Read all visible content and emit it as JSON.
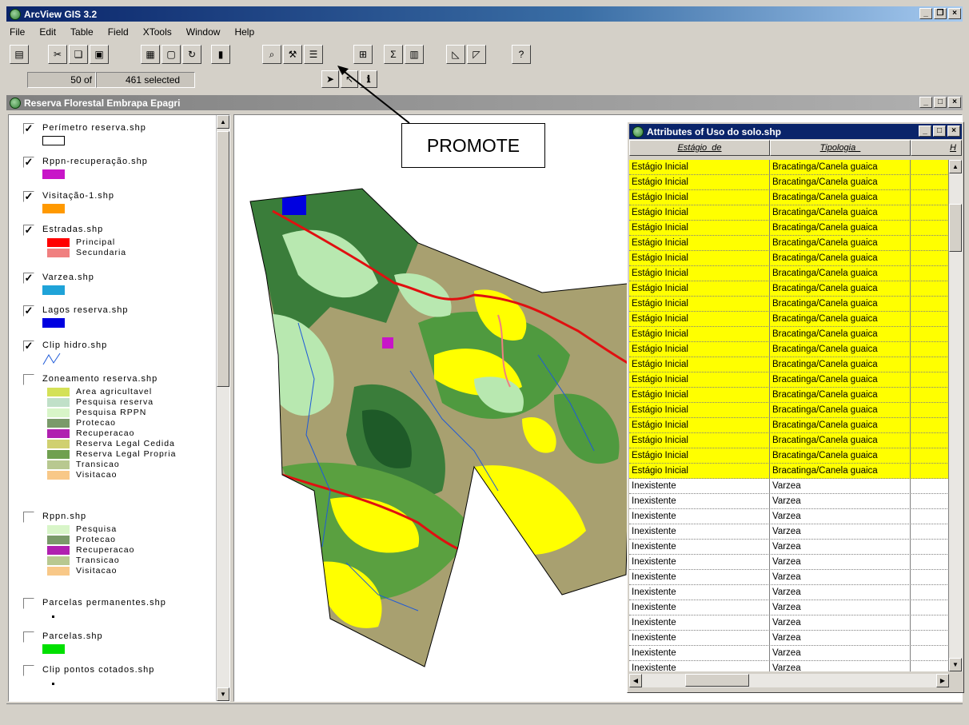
{
  "app": {
    "title": "ArcView GIS 3.2"
  },
  "menu": [
    "File",
    "Edit",
    "Table",
    "Field",
    "XTools",
    "Window",
    "Help"
  ],
  "toolbar": {
    "buttons": [
      "save",
      "cut",
      "copy",
      "paste",
      "table-open",
      "table-select",
      "refresh",
      "chart",
      "find",
      "query",
      "promote",
      "join",
      "statistics",
      "summarize",
      "sort-ascending",
      "sort-descending",
      "help"
    ]
  },
  "selection": {
    "selected_count": "50 of",
    "total": "461",
    "selected_label": "selected"
  },
  "project_window": {
    "title": "Reserva Florestal Embrapa Epagri"
  },
  "legend": {
    "layers": [
      {
        "name": "Perímetro reserva.shp",
        "checked": true,
        "swatch": "#ffffff",
        "outline": true
      },
      {
        "name": "Rppn-recuperação.shp",
        "checked": true,
        "swatch": "#c815c8"
      },
      {
        "name": "Visitação-1.shp",
        "checked": true,
        "swatch": "#ff9900"
      },
      {
        "name": "Estradas.shp",
        "checked": true,
        "classes": [
          {
            "label": "Principal",
            "color": "#ff0000"
          },
          {
            "label": "Secundaria",
            "color": "#f08080"
          }
        ]
      },
      {
        "name": "Varzea.shp",
        "checked": true,
        "swatch": "#1fa3d8"
      },
      {
        "name": "Lagos reserva.shp",
        "checked": true,
        "swatch": "#0000e0"
      },
      {
        "name": "Clip hidro.shp",
        "checked": true,
        "line": true
      },
      {
        "name": "Zoneamento reserva.shp",
        "checked": false,
        "classes": [
          {
            "label": "Area agricultavel",
            "color": "#d4e157"
          },
          {
            "label": "Pesquisa reserva",
            "color": "#c0e0c8"
          },
          {
            "label": "Pesquisa RPPN",
            "color": "#d8f5c8"
          },
          {
            "label": "Protecao",
            "color": "#7a9a6a"
          },
          {
            "label": "Recuperacao",
            "color": "#b020b0"
          },
          {
            "label": "Reserva Legal Cedida",
            "color": "#d0d070"
          },
          {
            "label": "Reserva Legal Propria",
            "color": "#70a050"
          },
          {
            "label": "Transicao",
            "color": "#b8c890"
          },
          {
            "label": "Visitacao",
            "color": "#f8c888"
          }
        ]
      },
      {
        "name": "Rppn.shp",
        "checked": false,
        "classes": [
          {
            "label": "Pesquisa",
            "color": "#d8f5c8"
          },
          {
            "label": "Protecao",
            "color": "#7a9a6a"
          },
          {
            "label": "Recuperacao",
            "color": "#b020b0"
          },
          {
            "label": "Transicao",
            "color": "#b8c890"
          },
          {
            "label": "Visitacao",
            "color": "#f8c888"
          }
        ]
      },
      {
        "name": "Parcelas permanentes.shp",
        "checked": false,
        "dot": true
      },
      {
        "name": "Parcelas.shp",
        "checked": false,
        "swatch": "#00e000"
      },
      {
        "name": "Clip pontos cotados.shp",
        "checked": false,
        "dot": true
      }
    ]
  },
  "attribute_table": {
    "title": "Attributes of Uso do solo.shp",
    "columns": [
      "Estágio_de",
      "Tipologia_",
      "H"
    ],
    "selected_color": "#ffff00",
    "rows": [
      [
        "Estágio Inicial",
        "Bracatinga/Canela guaica",
        "",
        true
      ],
      [
        "Estágio Inicial",
        "Bracatinga/Canela guaica",
        "",
        true
      ],
      [
        "Estágio Inicial",
        "Bracatinga/Canela guaica",
        "",
        true
      ],
      [
        "Estágio Inicial",
        "Bracatinga/Canela guaica",
        "",
        true
      ],
      [
        "Estágio Inicial",
        "Bracatinga/Canela guaica",
        "",
        true
      ],
      [
        "Estágio Inicial",
        "Bracatinga/Canela guaica",
        "",
        true
      ],
      [
        "Estágio Inicial",
        "Bracatinga/Canela guaica",
        "",
        true
      ],
      [
        "Estágio Inicial",
        "Bracatinga/Canela guaica",
        "",
        true
      ],
      [
        "Estágio Inicial",
        "Bracatinga/Canela guaica",
        "",
        true
      ],
      [
        "Estágio Inicial",
        "Bracatinga/Canela guaica",
        "",
        true
      ],
      [
        "Estágio Inicial",
        "Bracatinga/Canela guaica",
        "",
        true
      ],
      [
        "Estágio Inicial",
        "Bracatinga/Canela guaica",
        "",
        true
      ],
      [
        "Estágio Inicial",
        "Bracatinga/Canela guaica",
        "",
        true
      ],
      [
        "Estágio Inicial",
        "Bracatinga/Canela guaica",
        "",
        true
      ],
      [
        "Estágio Inicial",
        "Bracatinga/Canela guaica",
        "",
        true
      ],
      [
        "Estágio Inicial",
        "Bracatinga/Canela guaica",
        "",
        true
      ],
      [
        "Estágio Inicial",
        "Bracatinga/Canela guaica",
        "",
        true
      ],
      [
        "Estágio Inicial",
        "Bracatinga/Canela guaica",
        "",
        true
      ],
      [
        "Estágio Inicial",
        "Bracatinga/Canela guaica",
        "",
        true
      ],
      [
        "Estágio Inicial",
        "Bracatinga/Canela guaica",
        "",
        true
      ],
      [
        "Estágio Inicial",
        "Bracatinga/Canela guaica",
        "",
        true
      ],
      [
        "Inexistente",
        "Varzea",
        "",
        false
      ],
      [
        "Inexistente",
        "Varzea",
        "",
        false
      ],
      [
        "Inexistente",
        "Varzea",
        "",
        false
      ],
      [
        "Inexistente",
        "Varzea",
        "",
        false
      ],
      [
        "Inexistente",
        "Varzea",
        "",
        false
      ],
      [
        "Inexistente",
        "Varzea",
        "",
        false
      ],
      [
        "Inexistente",
        "Varzea",
        "",
        false
      ],
      [
        "Inexistente",
        "Varzea",
        "",
        false
      ],
      [
        "Inexistente",
        "Varzea",
        "",
        false
      ],
      [
        "Inexistente",
        "Varzea",
        "",
        false
      ],
      [
        "Inexistente",
        "Varzea",
        "",
        false
      ],
      [
        "Inexistente",
        "Varzea",
        "",
        false
      ],
      [
        "Inexistente",
        "Varzea",
        "",
        false
      ]
    ]
  },
  "annotation": {
    "label": "PROMOTE"
  }
}
